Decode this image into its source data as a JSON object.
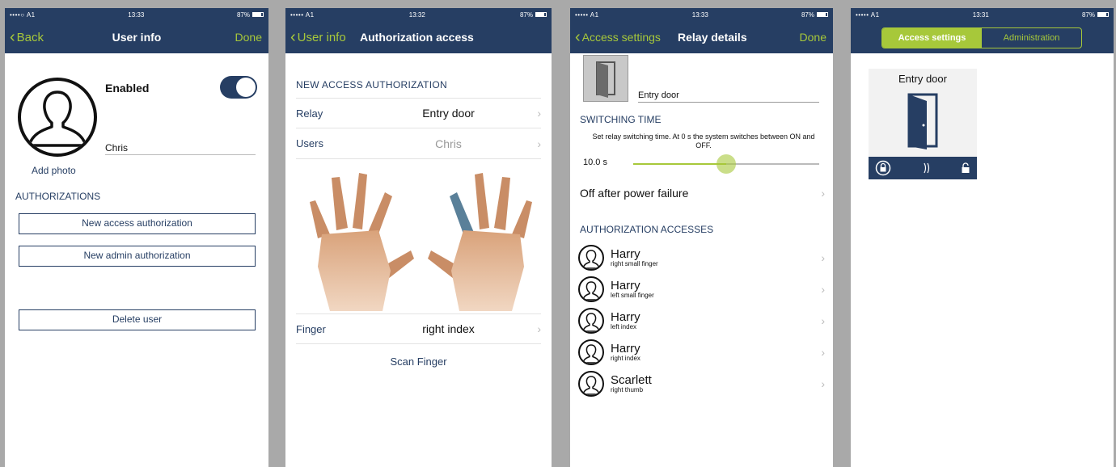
{
  "colors": {
    "navy": "#263e63",
    "accent": "#a7c83a"
  },
  "p1": {
    "status": {
      "carrier": "••••○ A1",
      "time": "13:33",
      "battery": "87%"
    },
    "nav": {
      "back": "Back",
      "title": "User info",
      "right": "Done"
    },
    "enabled_label": "Enabled",
    "name": "Chris",
    "add_photo": "Add photo",
    "authorizations_header": "AUTHORIZATIONS",
    "new_access_button": "New access authorization",
    "new_admin_button": "New admin authorization",
    "delete_button": "Delete user"
  },
  "p2": {
    "status": {
      "carrier": "••••• A1",
      "time": "13:32",
      "battery": "87%"
    },
    "nav": {
      "back": "User info",
      "title": "Authorization access"
    },
    "section": "NEW ACCESS AUTHORIZATION",
    "relay": {
      "label": "Relay",
      "value": "Entry door"
    },
    "users": {
      "label": "Users",
      "value": "Chris"
    },
    "finger": {
      "label": "Finger",
      "value": "right index"
    },
    "scan": "Scan Finger"
  },
  "p3": {
    "status": {
      "carrier": "••••• A1",
      "time": "13:33",
      "battery": "87%"
    },
    "nav": {
      "back": "Access settings",
      "title": "Relay details",
      "right": "Done"
    },
    "door_name": "Entry door",
    "switching_header": "SWITCHING TIME",
    "switching_desc": "Set relay switching time. At 0 s the system switches between ON and OFF.",
    "switching_value": "10.0 s",
    "switching_fraction": 0.5,
    "power_failure": "Off after power failure",
    "accesses_header": "AUTHORIZATION ACCESSES",
    "accesses": [
      {
        "name": "Harry",
        "finger": "right small finger"
      },
      {
        "name": "Harry",
        "finger": "left small finger"
      },
      {
        "name": "Harry",
        "finger": "left index"
      },
      {
        "name": "Harry",
        "finger": "right index"
      },
      {
        "name": "Scarlett",
        "finger": "right thumb"
      }
    ]
  },
  "p4": {
    "status": {
      "carrier": "••••• A1",
      "time": "13:31",
      "battery": "87%"
    },
    "tabs": [
      "Access settings",
      "Administration"
    ],
    "tile_title": "Entry door"
  }
}
